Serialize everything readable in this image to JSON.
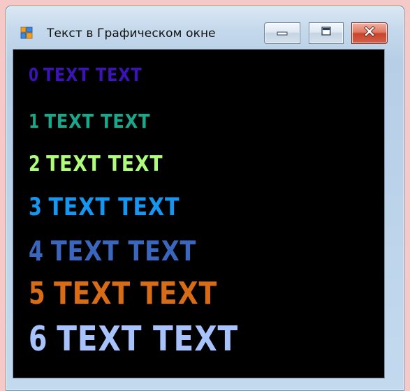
{
  "window": {
    "title": "Текст в Графическом окне",
    "controls": {
      "minimize": "minimize-icon",
      "maximize": "maximize-icon",
      "close": "close-icon"
    }
  },
  "canvas": {
    "background": "#000000",
    "lines": [
      {
        "number": "0",
        "text": "TEXT TEXT",
        "color": "#3c12b9"
      },
      {
        "number": "1",
        "text": "TEXT TEXT",
        "color": "#18a88a"
      },
      {
        "number": "2",
        "text": "TEXT TEXT",
        "color": "#aefc7a"
      },
      {
        "number": "3",
        "text": "TEXT TEXT",
        "color": "#1596f0"
      },
      {
        "number": "4",
        "text": "TEXT TEXT",
        "color": "#3a66bd"
      },
      {
        "number": "5",
        "text": "TEXT TEXT",
        "color": "#d86b16"
      },
      {
        "number": "6",
        "text": "TEXT TEXT",
        "color": "#a8c2fc"
      }
    ]
  }
}
